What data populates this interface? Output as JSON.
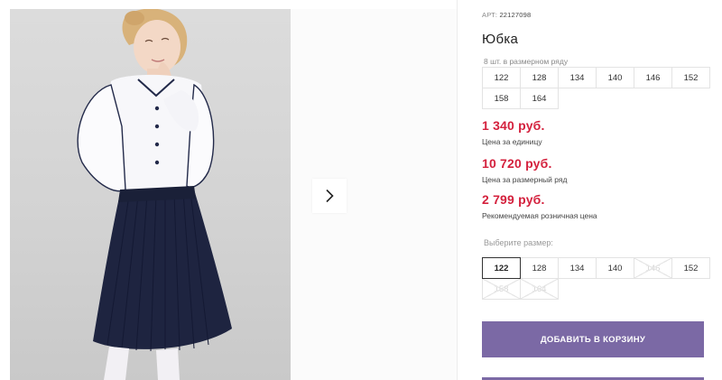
{
  "gallery": {
    "next_icon": "chevron-right-icon"
  },
  "product": {
    "article_prefix": "АРТ:",
    "article_number": "22127098",
    "title": "Юбка",
    "size_row_caption": "8 шт. в размерном ряду",
    "size_row": [
      "122",
      "128",
      "134",
      "140",
      "146",
      "152",
      "158",
      "164"
    ],
    "prices": [
      {
        "amount": "1 340 руб.",
        "label": "Цена за единицу"
      },
      {
        "amount": "10 720 руб.",
        "label": "Цена за размерный ряд"
      },
      {
        "amount": "2 799 руб.",
        "label": "Рекомендуемая розничная цена"
      }
    ],
    "choose_size_label": "Выберите размер:",
    "size_options": [
      {
        "size": "122",
        "state": "selected"
      },
      {
        "size": "128",
        "state": "available"
      },
      {
        "size": "134",
        "state": "available"
      },
      {
        "size": "140",
        "state": "available"
      },
      {
        "size": "146",
        "state": "unavailable"
      },
      {
        "size": "152",
        "state": "available"
      },
      {
        "size": "158",
        "state": "unavailable"
      },
      {
        "size": "164",
        "state": "unavailable"
      }
    ],
    "add_to_cart_label": "ДОБАВИТЬ В КОРЗИНУ"
  },
  "colors": {
    "price": "#d4213d",
    "button": "#7b69a5",
    "skirt": "#1e2440"
  }
}
